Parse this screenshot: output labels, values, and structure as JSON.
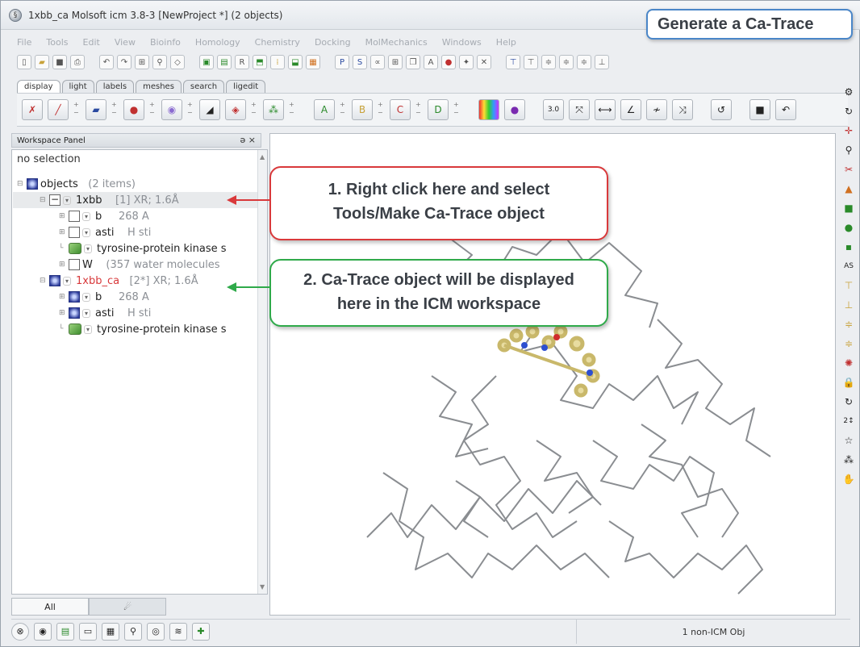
{
  "window": {
    "title": "1xbb_ca Molsoft icm 3.8-3  [NewProject *] (2 objects)"
  },
  "callouts": {
    "title": "Generate a Ca-Trace",
    "step1_line1": "1.   Right click here and select",
    "step1_line2": "Tools/Make Ca-Trace object",
    "step2_line1": "2. Ca-Trace object will be displayed",
    "step2_line2": "here in the ICM workspace"
  },
  "menu": [
    "File",
    "Tools",
    "Edit",
    "View",
    "Bioinfo",
    "Homology",
    "Chemistry",
    "Docking",
    "MolMechanics",
    "Windows",
    "Help"
  ],
  "tabs": [
    "display",
    "light",
    "labels",
    "meshes",
    "search",
    "ligedit"
  ],
  "workspace": {
    "header": "Workspace Panel",
    "header_controls": "ə ×",
    "selection": "no selection",
    "root": {
      "name": "objects",
      "count": "(2 items)"
    },
    "rows": [
      {
        "name": "1xbb",
        "info": "[1] XR; 1.6Å"
      },
      {
        "name": "b",
        "info": "268 A"
      },
      {
        "name": "asti",
        "info": "H  sti"
      },
      {
        "name": "tyrosine-protein kinase s",
        "info": ""
      },
      {
        "name": "W",
        "info": "(357 water molecules"
      },
      {
        "name": "1xbb_ca",
        "info": "[2*] XR; 1.6Å"
      },
      {
        "name": "b",
        "info": "268 A"
      },
      {
        "name": "asti",
        "info": "H  sti"
      },
      {
        "name": "tyrosine-protein kinase s",
        "info": ""
      }
    ]
  },
  "bottom_tabs": {
    "all": "All",
    "other": "☄"
  },
  "status": {
    "text": "1 non-ICM Obj"
  },
  "colors": {
    "red_callout": "#d9393b",
    "green_callout": "#2faa4a",
    "title_callout": "#4a86c8"
  }
}
